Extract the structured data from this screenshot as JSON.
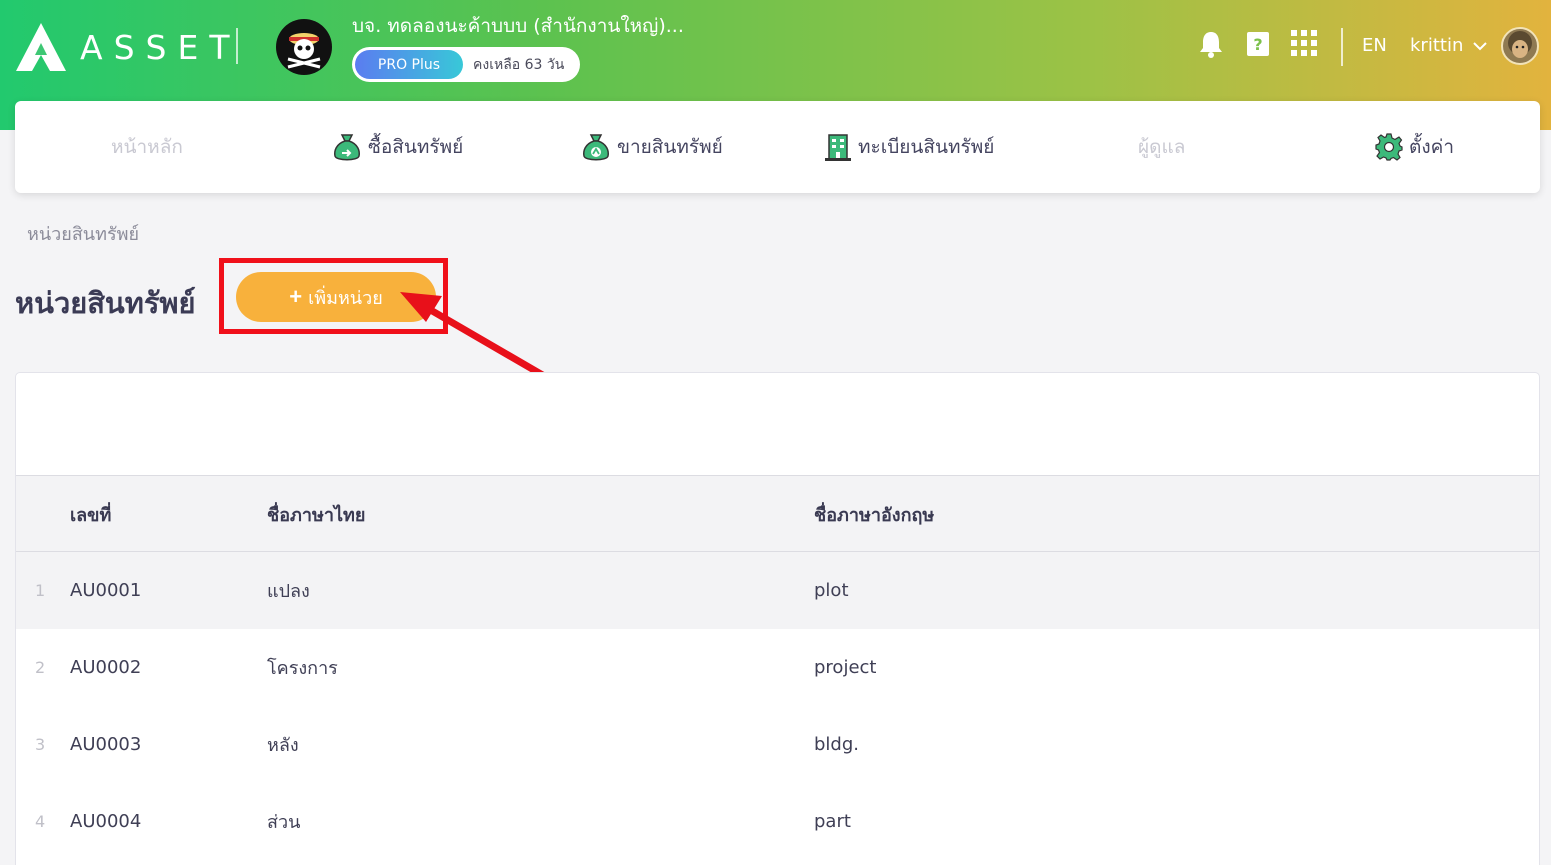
{
  "header": {
    "logo_text": "ASSET",
    "company_name": "บจ. ทดลองนะค้าบบบ (สำนักงานใหญ่)...",
    "plan": "PRO Plus",
    "plan_remaining": "คงเหลือ 63 วัน",
    "language": "EN",
    "username": "krittin"
  },
  "nav": {
    "items": [
      {
        "label": "หน้าหลัก",
        "icon": "home",
        "enabled": false
      },
      {
        "label": "ซื้อสินทรัพย์",
        "icon": "money-bag-icon",
        "enabled": true
      },
      {
        "label": "ขายสินทรัพย์",
        "icon": "money-bag-icon",
        "enabled": true
      },
      {
        "label": "ทะเบียนสินทรัพย์",
        "icon": "building-icon",
        "enabled": true
      },
      {
        "label": "ผู้ดูแล",
        "icon": "user",
        "enabled": false
      },
      {
        "label": "ตั้งค่า",
        "icon": "gear-icon",
        "enabled": true
      }
    ]
  },
  "breadcrumb": "หน่วยสินทรัพย์",
  "page": {
    "title": "หน่วยสินทรัพย์",
    "add_button": "เพิ่มหน่วย"
  },
  "table": {
    "columns": [
      "เลขที่",
      "ชื่อภาษาไทย",
      "ชื่อภาษาอังกฤษ"
    ],
    "rows": [
      {
        "index": "1",
        "code": "AU0001",
        "name_th": "แปลง",
        "name_en": "plot"
      },
      {
        "index": "2",
        "code": "AU0002",
        "name_th": "โครงการ",
        "name_en": "project"
      },
      {
        "index": "3",
        "code": "AU0003",
        "name_th": "หลัง",
        "name_en": "bldg."
      },
      {
        "index": "4",
        "code": "AU0004",
        "name_th": "ส่วน",
        "name_en": "part"
      }
    ]
  },
  "colors": {
    "header_gradient": [
      "#22c96e",
      "#e2b33e"
    ],
    "add_button": "#f8b13c",
    "highlight": "#f0101a",
    "nav_icon_green": "#3cb97a"
  }
}
